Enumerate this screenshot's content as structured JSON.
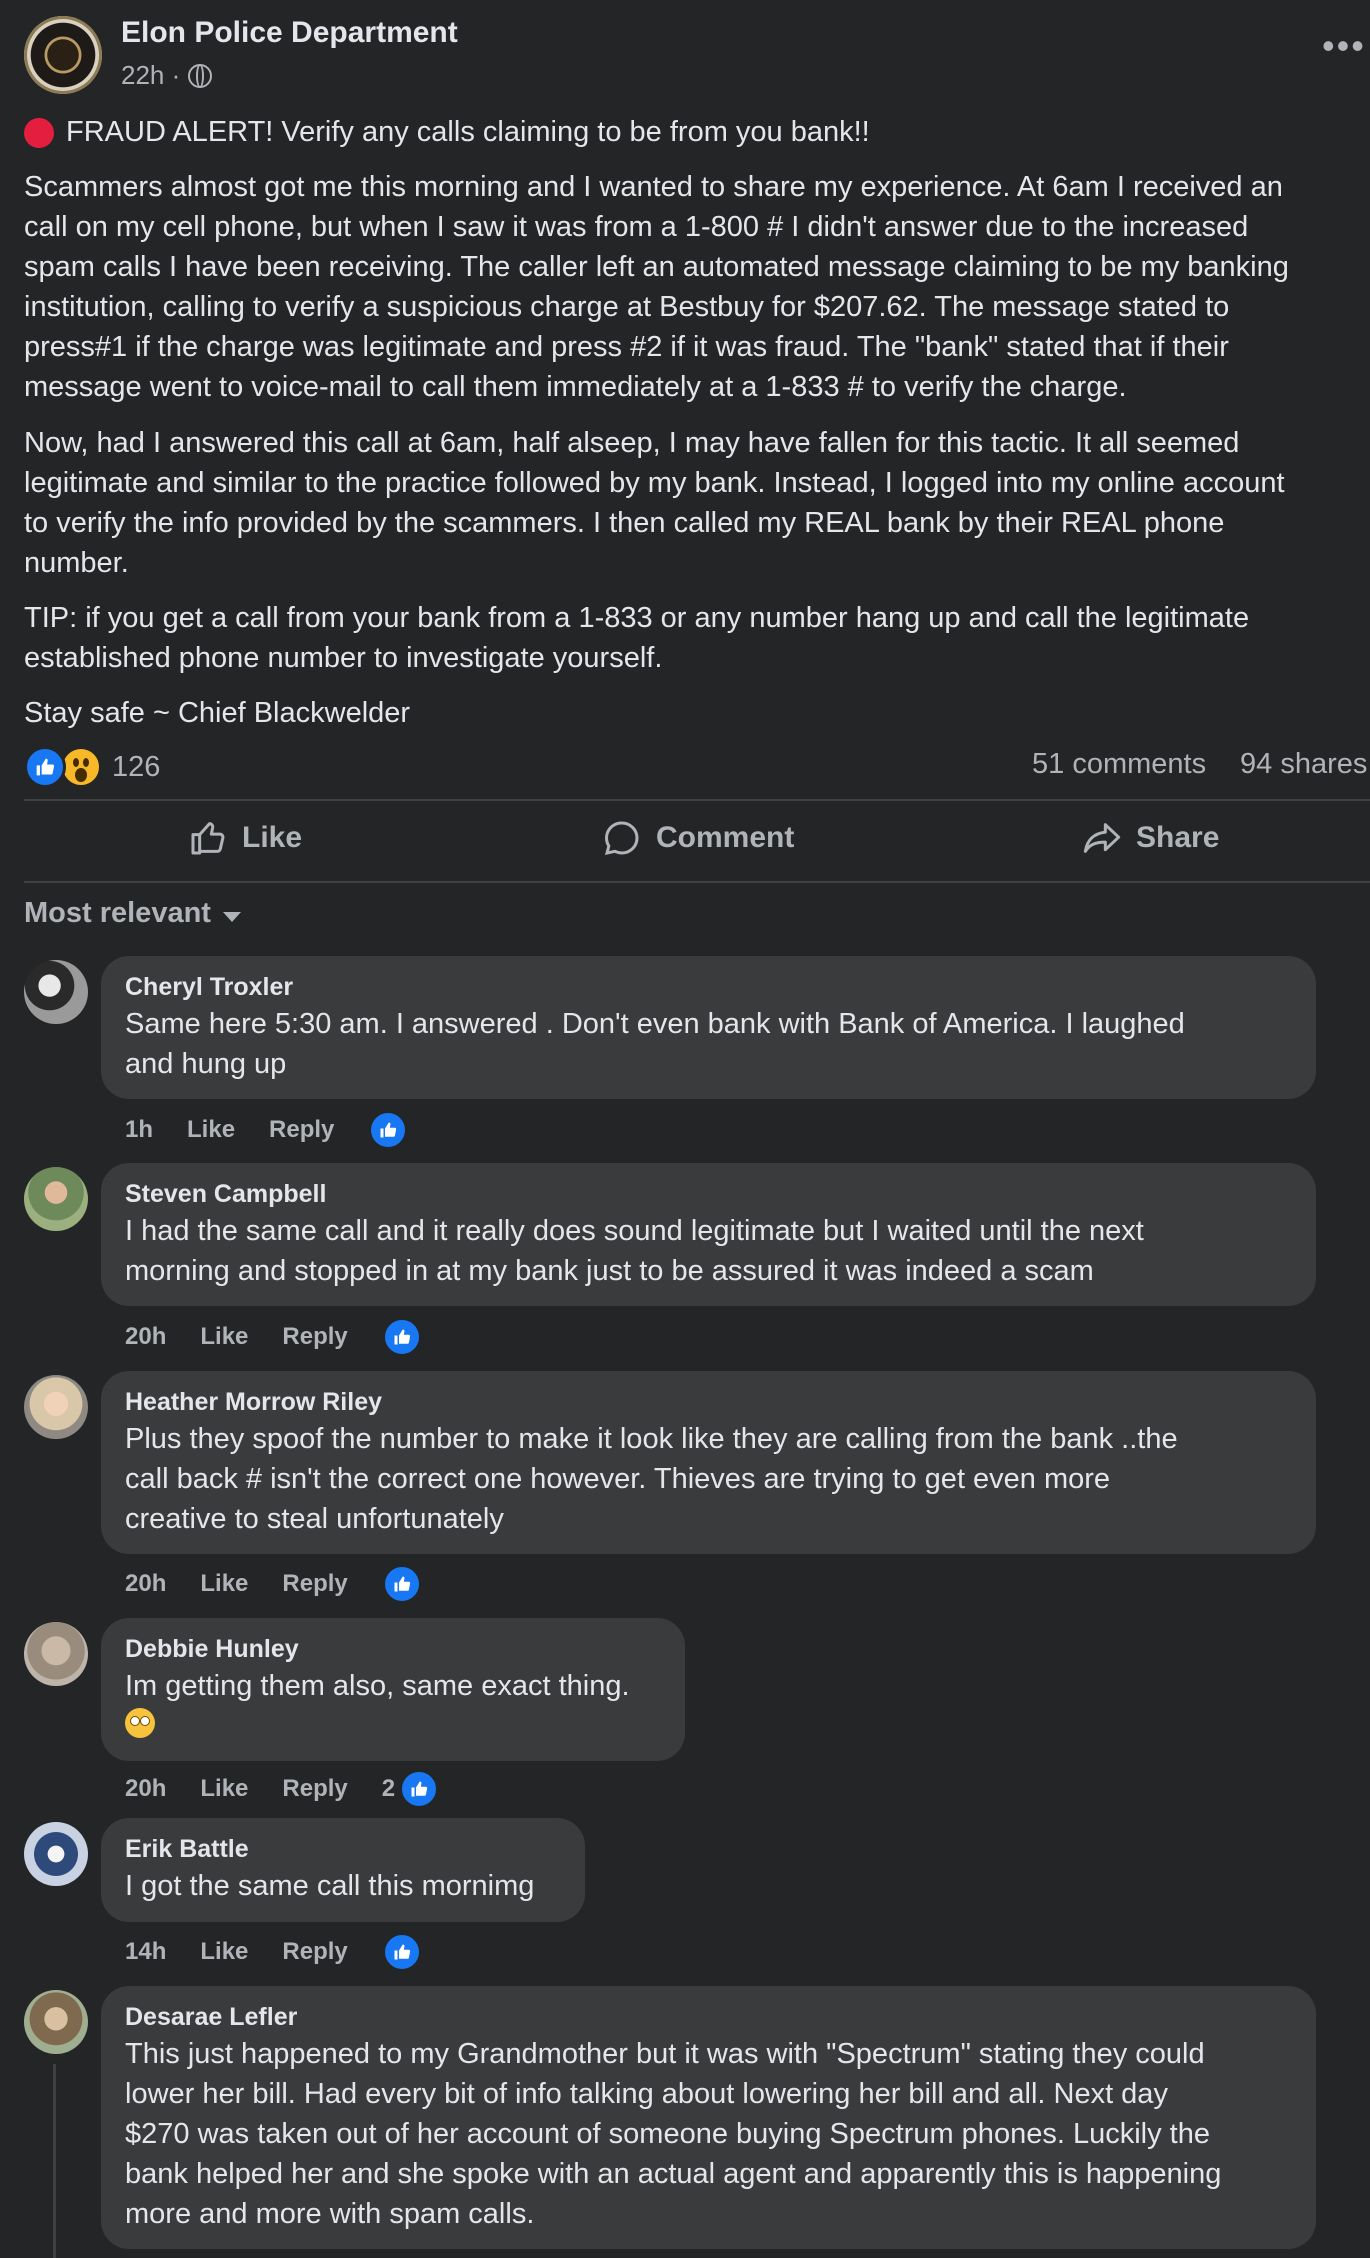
{
  "post": {
    "page_name": "Elon Police Department",
    "time": "22h ·",
    "more_label": "•••",
    "alert_title": "FRAUD ALERT! Verify any calls claiming to be from you bank!!",
    "paragraph1": "Scammers almost got me this morning and I wanted to share my experience. At 6am I received an\ncall on my cell phone, but when I saw it was from a 1-800 # I didn't answer due to the increased\nspam calls I have been receiving. The caller left an automated message claiming to be my banking\ninstitution, calling to verify a suspicious charge at Bestbuy for $207.62. The message stated to\npress#1 if the charge was legitimate and press #2 if it was fraud. The \"bank\" stated that if their\nmessage went to voice-mail to call them immediately at a 1-833 # to verify the charge.",
    "paragraph2": "Now, had I answered this call at 6am, half alseep, I may have fallen for this tactic. It all seemed\nlegitimate and similar to the practice followed by my bank. Instead, I logged into my online account\nto verify the info provided by the scammers. I then called my REAL bank by their REAL phone\nnumber.",
    "paragraph3": "TIP: if you get a call from your bank from a 1-833 or any number hang up and call the legitimate\nestablished phone number to investigate yourself.",
    "signoff": "Stay safe ~ Chief Blackwelder",
    "reaction_count": "126",
    "comments_count": "51 comments",
    "shares_count": "94 shares"
  },
  "actions": {
    "like": "Like",
    "comment": "Comment",
    "share": "Share"
  },
  "sort_label": "Most relevant",
  "comments": [
    {
      "name": "Cheryl Troxler",
      "text": "Same here 5:30 am. I answered . Don't even bank with Bank of America. I laughed\nand hung up",
      "time": "1h",
      "like": "Like",
      "reply": "Reply",
      "reaction_count": ""
    },
    {
      "name": "Steven Campbell",
      "text": "I had the same call and it really does sound legitimate but I waited until the next\nmorning and stopped in at my bank just to be assured it was indeed a scam",
      "time": "20h",
      "like": "Like",
      "reply": "Reply",
      "reaction_count": ""
    },
    {
      "name": "Heather Morrow Riley",
      "text": "Plus they spoof the number to make it look like they are calling from the bank ..the\ncall back # isn't the correct one however. Thieves are trying to get even more\ncreative to steal unfortunately",
      "time": "20h",
      "like": "Like",
      "reply": "Reply",
      "reaction_count": ""
    },
    {
      "name": "Debbie Hunley",
      "text": "Im getting them also, same exact thing.",
      "time": "20h",
      "like": "Like",
      "reply": "Reply",
      "reaction_count": "2"
    },
    {
      "name": "Erik Battle",
      "text": "I got the same call this mornimg",
      "time": "14h",
      "like": "Like",
      "reply": "Reply",
      "reaction_count": ""
    },
    {
      "name": "Desarae Lefler",
      "text": "This just happened to my Grandmother but it was with \"Spectrum\" stating they could\nlower her bill. Had every bit of info talking about lowering her bill and all. Next day\n$270 was taken out of her account of someone buying Spectrum phones. Luckily the\nbank helped her and she spoke with an actual agent and apparently this is happening\nmore and more with spam calls.",
      "time": "",
      "like": "",
      "reply": "",
      "reaction_count": ""
    }
  ]
}
